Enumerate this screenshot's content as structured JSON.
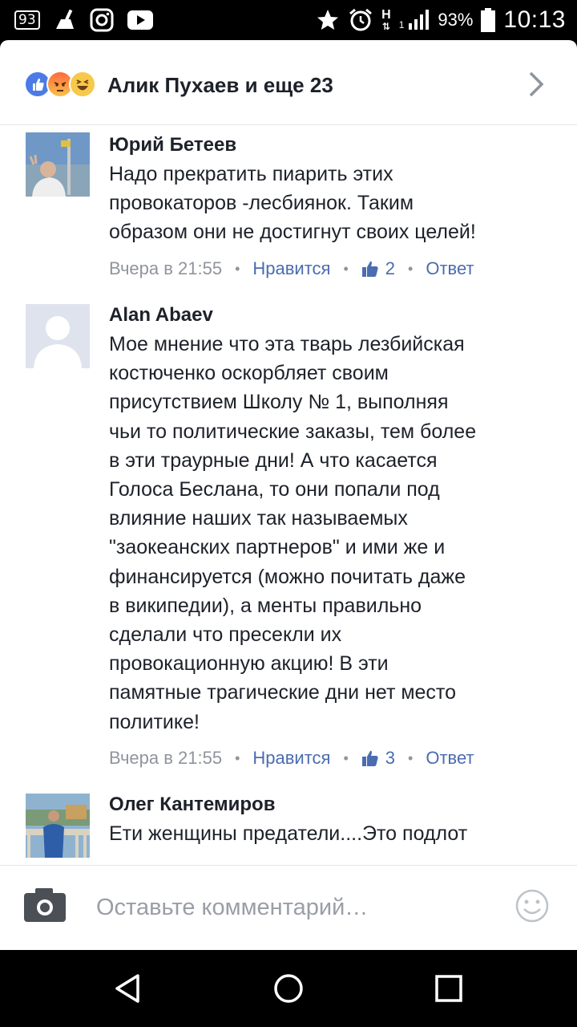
{
  "status_bar": {
    "notif_count": "93",
    "net_letter": "H",
    "sim": "1",
    "battery_pct": "93%",
    "time": "10:13"
  },
  "header": {
    "reactors_text": "Алик Пухаев и еще 23",
    "reactions": [
      "like",
      "angry",
      "haha"
    ]
  },
  "comments": [
    {
      "author": "Юрий Бетеев",
      "text": "Надо прекратить  пиарить этих\nпровокаторов -лесбиянок. Таким\nобразом они не достигнут своих целей!",
      "time": "Вчера в 21:55",
      "like_label": "Нравится",
      "likes": "2",
      "reply_label": "Ответ"
    },
    {
      "author": "Alan Abaev",
      "text": "Мое мнение что эта тварь лезбийская\nкостюченко оскорбляет своим\nприсутствием Школу № 1, выполняя\nчьи то политические заказы, тем более\nв эти траурные дни! А что касается\nГолоса Беслана, то они попали под\nвлияние наших так называемых\n\"заокеанских партнеров\" и ими же и\nфинансируется (можно почитать даже\nв википедии), а менты правильно\nсделали что пресекли их\nпровокационную  акцию! В эти\nпамятные трагические дни нет место\nполитике!",
      "time": "Вчера в 21:55",
      "like_label": "Нравится",
      "likes": "3",
      "reply_label": "Ответ"
    },
    {
      "author": "Олег Кантемиров",
      "text": "Ети женщины предатели....Это подлот"
    }
  ],
  "composer": {
    "placeholder": "Оставьте комментарий…"
  },
  "colors": {
    "link": "#4b6cb0",
    "meta": "#90949c",
    "text": "#1d2129",
    "like_reaction": "#4c7be8"
  }
}
